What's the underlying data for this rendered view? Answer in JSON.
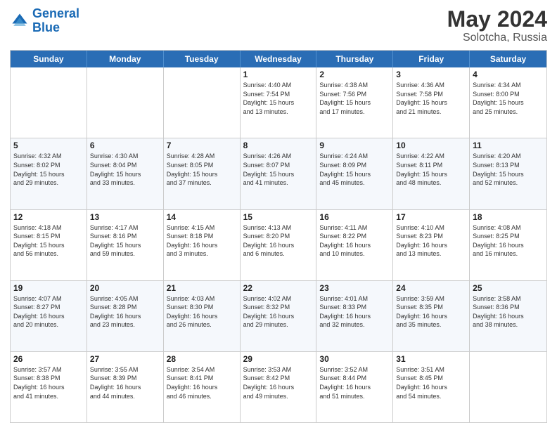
{
  "header": {
    "logo_line1": "General",
    "logo_line2": "Blue",
    "title": "May 2024",
    "location": "Solotcha, Russia"
  },
  "weekdays": [
    "Sunday",
    "Monday",
    "Tuesday",
    "Wednesday",
    "Thursday",
    "Friday",
    "Saturday"
  ],
  "rows": [
    [
      {
        "day": "",
        "info": ""
      },
      {
        "day": "",
        "info": ""
      },
      {
        "day": "",
        "info": ""
      },
      {
        "day": "1",
        "info": "Sunrise: 4:40 AM\nSunset: 7:54 PM\nDaylight: 15 hours\nand 13 minutes."
      },
      {
        "day": "2",
        "info": "Sunrise: 4:38 AM\nSunset: 7:56 PM\nDaylight: 15 hours\nand 17 minutes."
      },
      {
        "day": "3",
        "info": "Sunrise: 4:36 AM\nSunset: 7:58 PM\nDaylight: 15 hours\nand 21 minutes."
      },
      {
        "day": "4",
        "info": "Sunrise: 4:34 AM\nSunset: 8:00 PM\nDaylight: 15 hours\nand 25 minutes."
      }
    ],
    [
      {
        "day": "5",
        "info": "Sunrise: 4:32 AM\nSunset: 8:02 PM\nDaylight: 15 hours\nand 29 minutes."
      },
      {
        "day": "6",
        "info": "Sunrise: 4:30 AM\nSunset: 8:04 PM\nDaylight: 15 hours\nand 33 minutes."
      },
      {
        "day": "7",
        "info": "Sunrise: 4:28 AM\nSunset: 8:05 PM\nDaylight: 15 hours\nand 37 minutes."
      },
      {
        "day": "8",
        "info": "Sunrise: 4:26 AM\nSunset: 8:07 PM\nDaylight: 15 hours\nand 41 minutes."
      },
      {
        "day": "9",
        "info": "Sunrise: 4:24 AM\nSunset: 8:09 PM\nDaylight: 15 hours\nand 45 minutes."
      },
      {
        "day": "10",
        "info": "Sunrise: 4:22 AM\nSunset: 8:11 PM\nDaylight: 15 hours\nand 48 minutes."
      },
      {
        "day": "11",
        "info": "Sunrise: 4:20 AM\nSunset: 8:13 PM\nDaylight: 15 hours\nand 52 minutes."
      }
    ],
    [
      {
        "day": "12",
        "info": "Sunrise: 4:18 AM\nSunset: 8:15 PM\nDaylight: 15 hours\nand 56 minutes."
      },
      {
        "day": "13",
        "info": "Sunrise: 4:17 AM\nSunset: 8:16 PM\nDaylight: 15 hours\nand 59 minutes."
      },
      {
        "day": "14",
        "info": "Sunrise: 4:15 AM\nSunset: 8:18 PM\nDaylight: 16 hours\nand 3 minutes."
      },
      {
        "day": "15",
        "info": "Sunrise: 4:13 AM\nSunset: 8:20 PM\nDaylight: 16 hours\nand 6 minutes."
      },
      {
        "day": "16",
        "info": "Sunrise: 4:11 AM\nSunset: 8:22 PM\nDaylight: 16 hours\nand 10 minutes."
      },
      {
        "day": "17",
        "info": "Sunrise: 4:10 AM\nSunset: 8:23 PM\nDaylight: 16 hours\nand 13 minutes."
      },
      {
        "day": "18",
        "info": "Sunrise: 4:08 AM\nSunset: 8:25 PM\nDaylight: 16 hours\nand 16 minutes."
      }
    ],
    [
      {
        "day": "19",
        "info": "Sunrise: 4:07 AM\nSunset: 8:27 PM\nDaylight: 16 hours\nand 20 minutes."
      },
      {
        "day": "20",
        "info": "Sunrise: 4:05 AM\nSunset: 8:28 PM\nDaylight: 16 hours\nand 23 minutes."
      },
      {
        "day": "21",
        "info": "Sunrise: 4:03 AM\nSunset: 8:30 PM\nDaylight: 16 hours\nand 26 minutes."
      },
      {
        "day": "22",
        "info": "Sunrise: 4:02 AM\nSunset: 8:32 PM\nDaylight: 16 hours\nand 29 minutes."
      },
      {
        "day": "23",
        "info": "Sunrise: 4:01 AM\nSunset: 8:33 PM\nDaylight: 16 hours\nand 32 minutes."
      },
      {
        "day": "24",
        "info": "Sunrise: 3:59 AM\nSunset: 8:35 PM\nDaylight: 16 hours\nand 35 minutes."
      },
      {
        "day": "25",
        "info": "Sunrise: 3:58 AM\nSunset: 8:36 PM\nDaylight: 16 hours\nand 38 minutes."
      }
    ],
    [
      {
        "day": "26",
        "info": "Sunrise: 3:57 AM\nSunset: 8:38 PM\nDaylight: 16 hours\nand 41 minutes."
      },
      {
        "day": "27",
        "info": "Sunrise: 3:55 AM\nSunset: 8:39 PM\nDaylight: 16 hours\nand 44 minutes."
      },
      {
        "day": "28",
        "info": "Sunrise: 3:54 AM\nSunset: 8:41 PM\nDaylight: 16 hours\nand 46 minutes."
      },
      {
        "day": "29",
        "info": "Sunrise: 3:53 AM\nSunset: 8:42 PM\nDaylight: 16 hours\nand 49 minutes."
      },
      {
        "day": "30",
        "info": "Sunrise: 3:52 AM\nSunset: 8:44 PM\nDaylight: 16 hours\nand 51 minutes."
      },
      {
        "day": "31",
        "info": "Sunrise: 3:51 AM\nSunset: 8:45 PM\nDaylight: 16 hours\nand 54 minutes."
      },
      {
        "day": "",
        "info": ""
      }
    ]
  ]
}
